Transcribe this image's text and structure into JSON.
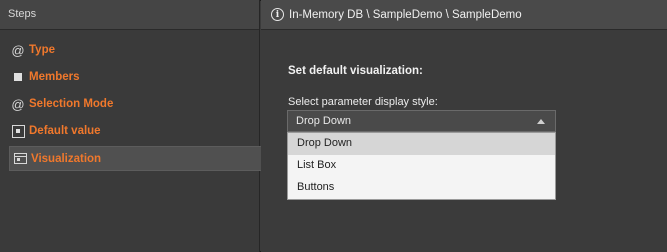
{
  "left_panel": {
    "header": "Steps",
    "steps": [
      {
        "label": "Type",
        "icon": "at-icon"
      },
      {
        "label": "Members",
        "icon": "square-icon"
      },
      {
        "label": "Selection Mode",
        "icon": "at-icon"
      },
      {
        "label": "Default value",
        "icon": "default-value-icon"
      },
      {
        "label": "Visualization",
        "icon": "visualization-icon"
      }
    ],
    "active_step": "Visualization"
  },
  "right_panel": {
    "breadcrumb": "In-Memory DB \\ SampleDemo \\ SampleDemo",
    "title": "Set default visualization:",
    "select_label": "Select parameter display style:",
    "select": {
      "value": "Drop Down",
      "options": [
        "Drop Down",
        "List Box",
        "Buttons"
      ],
      "highlighted": "Drop Down"
    }
  },
  "colors": {
    "accent": "#f0782c",
    "background": "#3b3b3b",
    "dropdown_bg": "#f4f4f4",
    "dropdown_highlight": "#d6d6d6"
  }
}
